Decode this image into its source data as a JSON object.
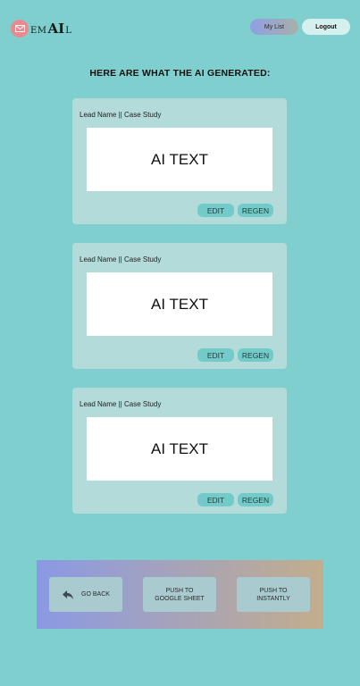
{
  "header": {
    "logo": {
      "em": "EM",
      "ai": "AI",
      "l": "L",
      "icon": "mail-icon"
    },
    "mylist_label": "My List",
    "logout_label": "Logout"
  },
  "main": {
    "title": "HERE ARE WHAT THE AI GENERATED:",
    "cards": [
      {
        "label": "Lead Name || Case Study",
        "text": "AI TEXT",
        "edit_label": "EDIT",
        "regen_label": "REGEN"
      },
      {
        "label": "Lead Name || Case Study",
        "text": "AI TEXT",
        "edit_label": "EDIT",
        "regen_label": "REGEN"
      },
      {
        "label": "Lead Name || Case Study",
        "text": "AI TEXT",
        "edit_label": "EDIT",
        "regen_label": "REGEN"
      }
    ]
  },
  "footer": {
    "go_back_label": "GO BACK",
    "go_back_icon": "reply-arrow-icon",
    "push_gsheet_line1": "PUSH TO",
    "push_gsheet_line2": "GOOGLE SHEET",
    "push_instantly_line1": "PUSH TO",
    "push_instantly_line2": "INSTANTLY"
  },
  "colors": {
    "background": "#7ecfcd",
    "card": "#b2dbd9",
    "button": "#72cbc9",
    "logo_circle": "#e98a8f"
  }
}
